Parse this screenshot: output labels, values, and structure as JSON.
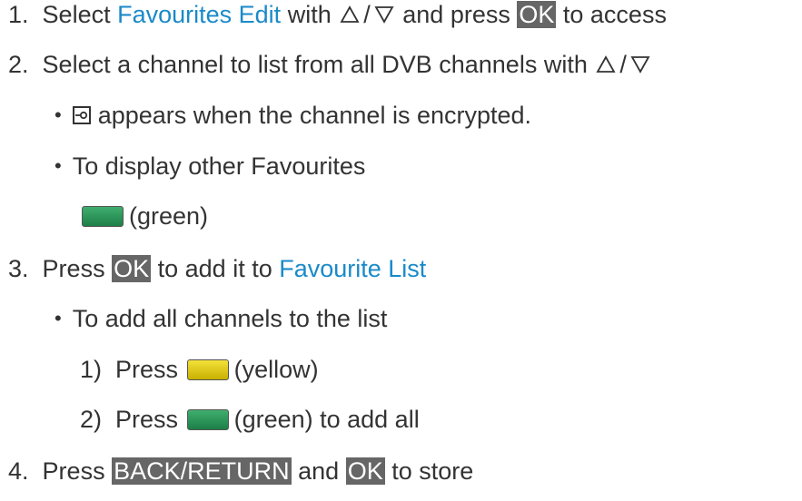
{
  "steps": {
    "s1": {
      "num": "1.",
      "pre": "Select",
      "link": "Favourites Edit",
      "with": "with",
      "slash": "/",
      "and": "and press",
      "key": "OK",
      "post": "to access",
      "icons": [
        "triangle-up-icon",
        "triangle-down-icon"
      ]
    },
    "s2": {
      "num": "2.",
      "text": "Select a channel to list from all DVB channels with",
      "slash": "/",
      "icons": [
        "triangle-up-icon",
        "triangle-down-icon"
      ]
    },
    "b1": {
      "bullet": "•",
      "icon": "encrypted-key-icon",
      "text": "appears when the channel is encrypted."
    },
    "b2": {
      "bullet": "•",
      "text": "To display other Favourites"
    },
    "g1": {
      "color_label": "(green)",
      "color": "#2e9a5c"
    },
    "s3": {
      "num": "3.",
      "pre": "Press",
      "key": "OK",
      "mid": "to add it to",
      "link": "Favourite List"
    },
    "b3": {
      "bullet": "•",
      "text": "To add all channels to the list"
    },
    "sub1": {
      "num": "1)",
      "pre": "Press",
      "color_label": "(yellow)",
      "color": "#e6d11f"
    },
    "sub2": {
      "num": "2)",
      "pre": "Press",
      "post": "(green) to add all",
      "color": "#2e9a5c"
    },
    "s4": {
      "num": "4.",
      "pre": "Press",
      "key1": "BACK/RETURN",
      "mid": "and",
      "key2": "OK",
      "post": "to store"
    }
  },
  "colors": {
    "link": "#1a8ac9",
    "key_bg": "#666666",
    "text": "#333333"
  }
}
